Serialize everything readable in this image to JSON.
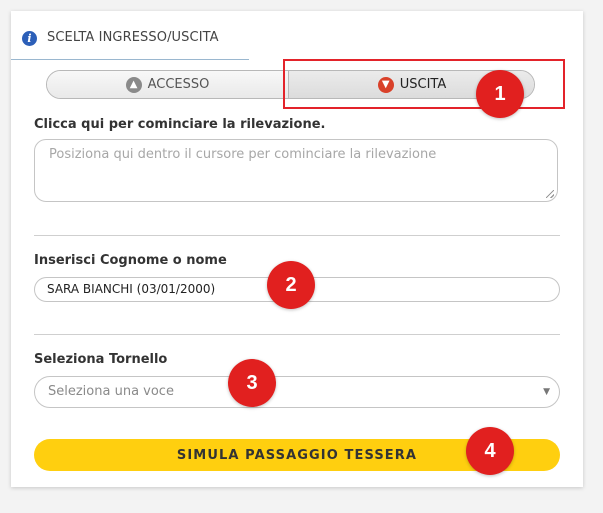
{
  "header": {
    "title": "SCELTA INGRESSO/USCITA",
    "icon": "info-icon"
  },
  "toggle": {
    "left_label": "ACCESSO",
    "left_icon": "arrow-up-icon",
    "right_label": "USCITA",
    "right_icon": "arrow-down-icon",
    "selected": "USCITA"
  },
  "form": {
    "start_label": "Clicca qui per cominciare la rilevazione.",
    "start_placeholder": "Posiziona qui dentro il cursore per cominciare la rilevazione",
    "name_label": "Inserisci Cognome o nome",
    "name_value": "SARA BIANCHI (03/01/2000)",
    "turnstile_label": "Seleziona Tornello",
    "turnstile_placeholder": "Seleziona una voce",
    "submit_label": "SIMULA PASSAGGIO TESSERA"
  },
  "badges": [
    "1",
    "2",
    "3",
    "4"
  ],
  "colors": {
    "accent_yellow": "#ffcf0f",
    "badge_red": "#e1201f",
    "highlight_red": "#e3232a",
    "info_blue": "#2c5fb8"
  }
}
